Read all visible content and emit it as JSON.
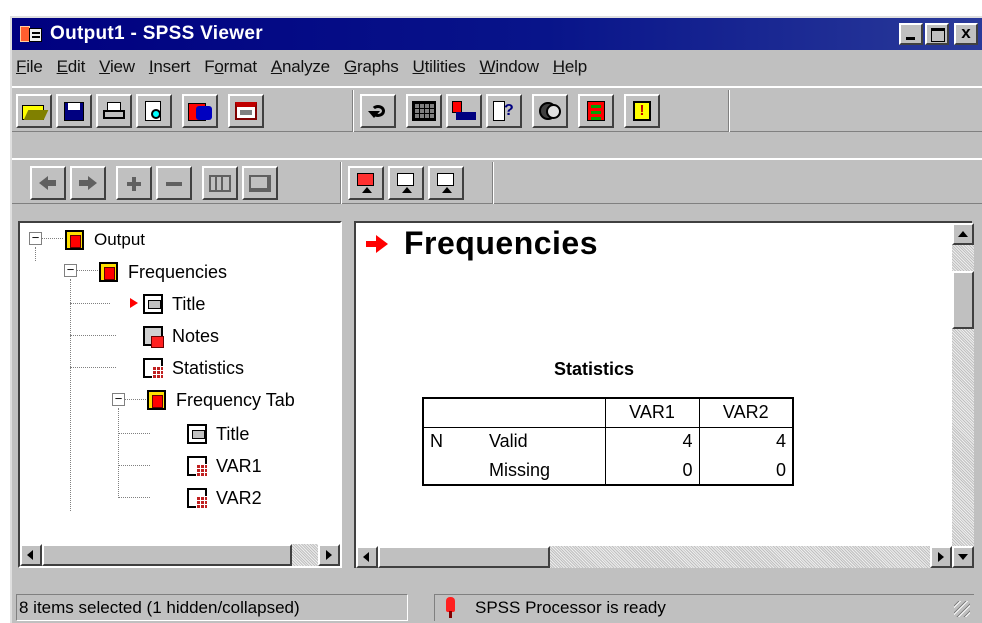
{
  "window": {
    "title": "Output1 - SPSS Viewer",
    "app_icon": "spss-viewer-icon",
    "controls": {
      "minimize_icon": "minimize-icon",
      "maximize_icon": "maximize-icon",
      "close_label": "x"
    }
  },
  "menu": [
    {
      "label": "File",
      "mnemonic": "F",
      "rest": "ile"
    },
    {
      "label": "Edit",
      "mnemonic": "E",
      "rest": "dit"
    },
    {
      "label": "View",
      "mnemonic": "V",
      "rest": "iew"
    },
    {
      "label": "Insert",
      "mnemonic": "I",
      "rest": "nsert"
    },
    {
      "label": "Format",
      "pre": "F",
      "mnemonic": "o",
      "rest": "rmat"
    },
    {
      "label": "Analyze",
      "mnemonic": "A",
      "rest": "nalyze"
    },
    {
      "label": "Graphs",
      "mnemonic": "G",
      "rest": "raphs"
    },
    {
      "label": "Utilities",
      "mnemonic": "U",
      "rest": "tilities"
    },
    {
      "label": "Window",
      "mnemonic": "W",
      "rest": "indow"
    },
    {
      "label": "Help",
      "mnemonic": "H",
      "rest": "elp"
    }
  ],
  "toolbar1": {
    "groups": [
      [
        "open-icon",
        "save-icon",
        "print-icon",
        "print-preview-icon",
        "export-icon",
        "recall-dialog-icon"
      ],
      [
        "undo-icon",
        "data-editor-icon",
        "goto-case-icon",
        "variables-icon",
        "use-sets-icon",
        "run-script-icon",
        "designate-window-icon"
      ]
    ]
  },
  "toolbar2": {
    "groups": [
      [
        "back-icon",
        "forward-icon"
      ],
      [
        "expand-icon",
        "collapse-icon"
      ],
      [
        "show-icon",
        "hide-icon"
      ],
      [
        "insert-heading-icon",
        "insert-title-icon",
        "insert-text-icon"
      ]
    ]
  },
  "outline": {
    "items": [
      {
        "label": "Output",
        "icon": "book-icon",
        "expanded": true
      },
      {
        "label": "Frequencies",
        "icon": "book-icon",
        "expanded": true
      },
      {
        "label": "Title",
        "icon": "title-page-icon",
        "current": true
      },
      {
        "label": "Notes",
        "icon": "notes-page-icon"
      },
      {
        "label": "Statistics",
        "icon": "table-page-icon"
      },
      {
        "label": "Frequency Tab",
        "icon": "book-icon",
        "expanded": true
      },
      {
        "label": "Title",
        "icon": "title-page-icon"
      },
      {
        "label": "VAR1",
        "icon": "table-page-icon"
      },
      {
        "label": "VAR2",
        "icon": "table-page-icon"
      }
    ]
  },
  "content": {
    "heading": "Frequencies",
    "statistics_table": {
      "caption": "Statistics",
      "columns": [
        "VAR1",
        "VAR2"
      ],
      "rows": [
        {
          "group": "N",
          "label": "Valid",
          "values": [
            "4",
            "4"
          ]
        },
        {
          "group": "",
          "label": "Missing",
          "values": [
            "0",
            "0"
          ]
        }
      ]
    }
  },
  "status": {
    "selection": "8 items selected (1 hidden/collapsed)",
    "processor": "SPSS Processor  is ready"
  },
  "colors": {
    "titlebar": "#000080",
    "face": "#c0c0c0",
    "current_arrow": "#ff0000"
  }
}
